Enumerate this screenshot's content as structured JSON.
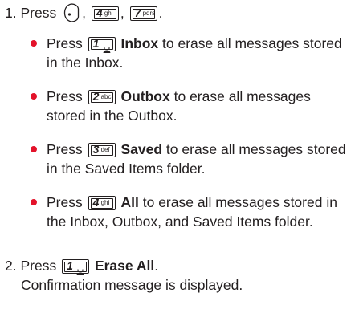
{
  "step1": {
    "number": "1. Press",
    "softkey_icon": "left-soft-key-icon",
    "sep1": ",",
    "sep2": ",",
    "end": ".",
    "keys": [
      {
        "digit": "4",
        "letters": "ghi"
      },
      {
        "digit": "7",
        "letters": "pqrs"
      }
    ]
  },
  "bullets": [
    {
      "press": "Press",
      "key_digit": "1",
      "key_icon": "voicemail-icon",
      "label": "Inbox",
      "line1": "to erase all messages stored",
      "line2": "in the Inbox."
    },
    {
      "press": "Press",
      "key_digit": "2",
      "key_letters": "abc",
      "label": "Outbox",
      "line1": "to erase all messages",
      "line2": "stored in the Outbox."
    },
    {
      "press": "Press",
      "key_digit": "3",
      "key_letters": "def",
      "label": "Saved",
      "line1": "to erase all messages stored",
      "line2": "in the Saved Items folder."
    },
    {
      "press": "Press",
      "key_digit": "4",
      "key_letters": "ghi",
      "label": "All",
      "line1": "to erase all messages stored in",
      "line2": "the Inbox, Outbox, and Saved Items folder."
    }
  ],
  "step2": {
    "number": "2. Press",
    "key_digit": "1",
    "key_icon": "voicemail-icon",
    "label": "Erase All",
    "end": ".",
    "sub": "Confirmation message is displayed."
  },
  "colors": {
    "text": "#231f20",
    "bullet": "#e3122a"
  }
}
